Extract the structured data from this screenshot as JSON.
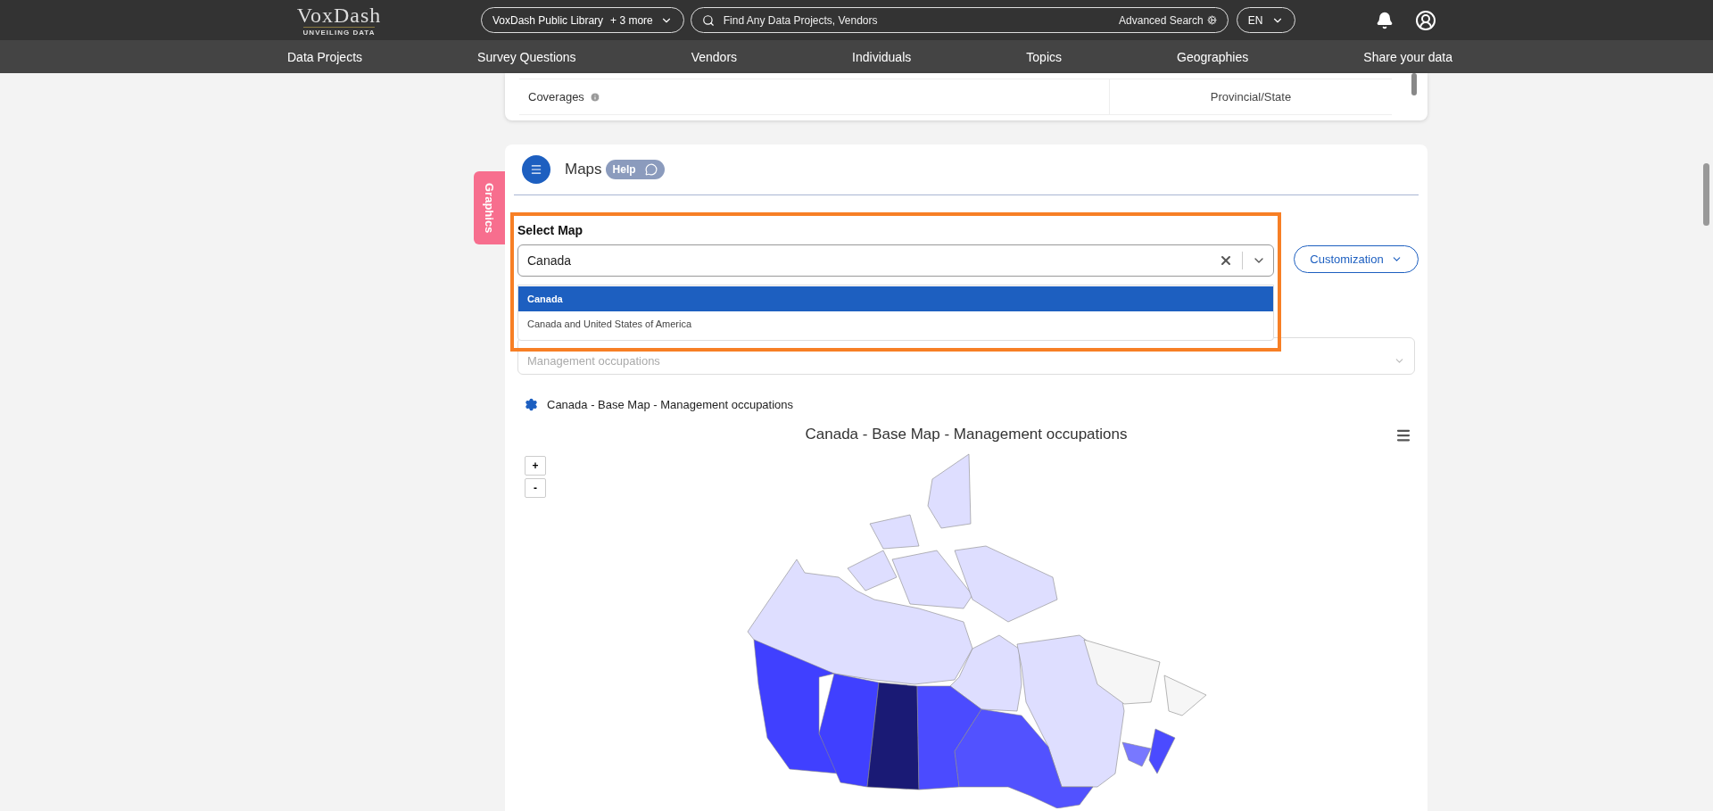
{
  "header": {
    "logo": "VoxDash",
    "tagline": "UNVEILING DATA",
    "library": {
      "label": "VoxDash Public Library",
      "extra": "+ 3 more"
    },
    "search": {
      "placeholder": "Find Any Data Projects, Vendors",
      "advanced": "Advanced Search"
    },
    "language": "EN"
  },
  "nav": [
    "Data Projects",
    "Survey Questions",
    "Vendors",
    "Individuals",
    "Topics",
    "Geographies",
    "Share your data"
  ],
  "details": {
    "rows": [
      {
        "label": "Coverages",
        "value": "Provincial/State"
      }
    ]
  },
  "side_tab": "Graphics",
  "maps": {
    "title": "Maps",
    "help": "Help",
    "select_label": "Select Map",
    "select_value": "Canada",
    "options": [
      {
        "label": "Canada",
        "selected": true
      },
      {
        "label": "Canada and United States of America",
        "selected": false
      }
    ],
    "customization": "Customization",
    "variable": "Management occupations",
    "settings_title": "Canada - Base Map - Management occupations",
    "chart_title": "Canada - Base Map - Management occupations",
    "zoom_in": "+",
    "zoom_out": "-"
  }
}
